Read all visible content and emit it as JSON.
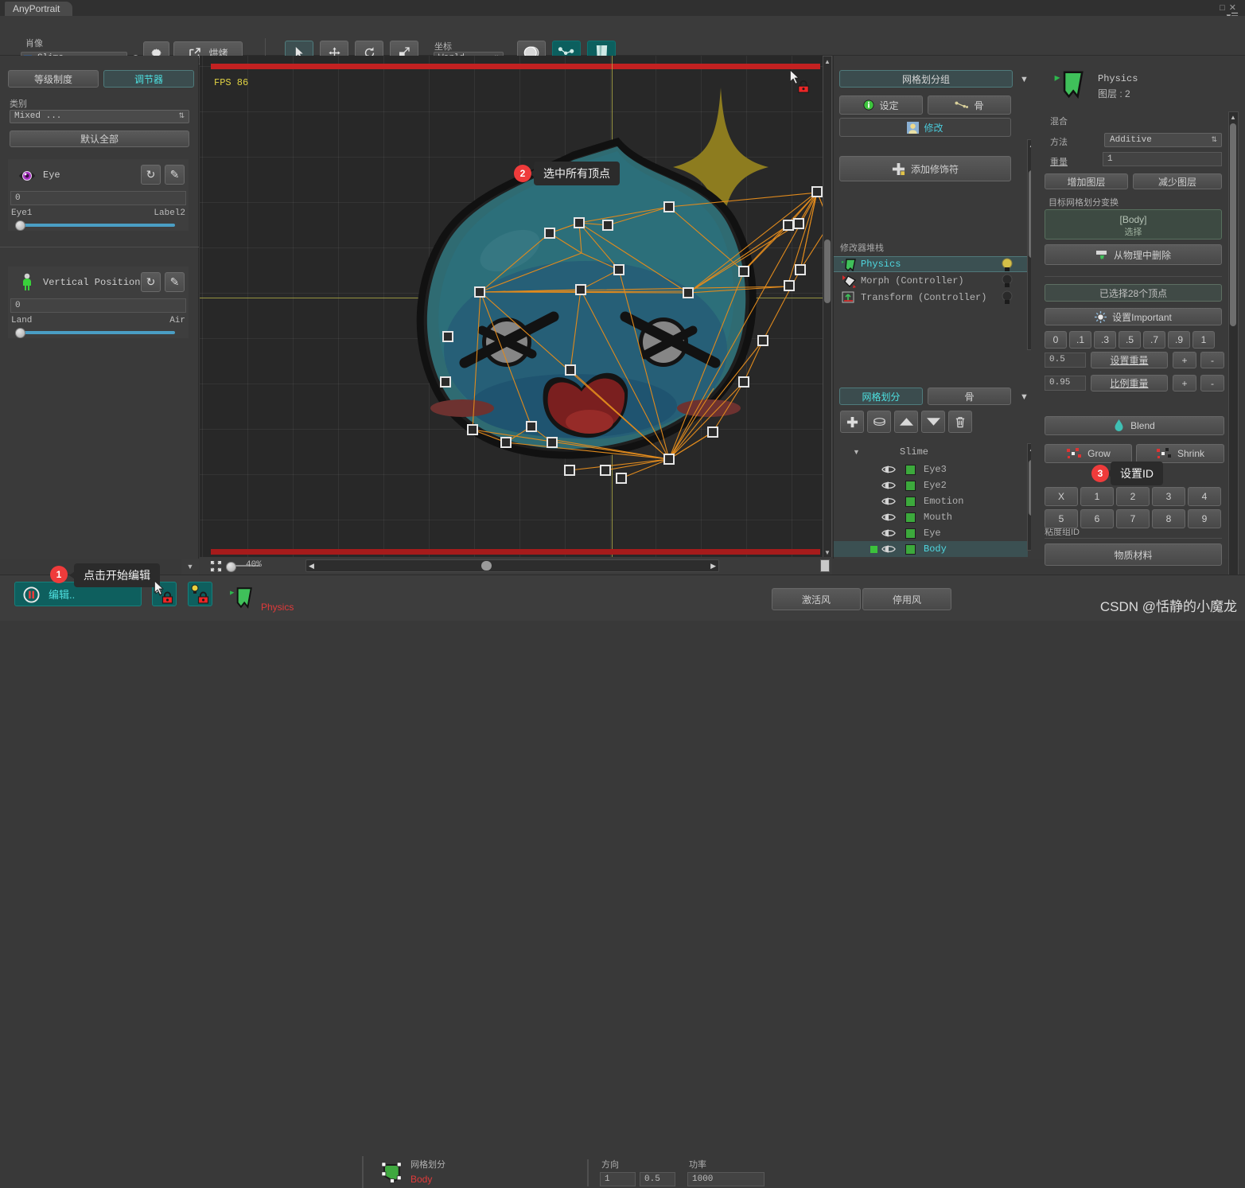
{
  "window": {
    "tab_title": "AnyPortrait",
    "maximize_icon": "maximize-icon",
    "close_icon": "close-icon",
    "menu_icon": "hamburger-menu-icon"
  },
  "toolbar": {
    "portrait_label": "肖像",
    "portrait_value": "Slime (apPortrait)",
    "gear_icon": "gear-icon",
    "bake_label": "烘烤",
    "bake_icon": "external-link-icon",
    "tools": [
      {
        "name": "select-tool",
        "icon": "cursor-arrow-icon",
        "active": true
      },
      {
        "name": "move-tool",
        "icon": "move-arrows-icon",
        "active": false
      },
      {
        "name": "rotate-tool",
        "icon": "rotate-icon",
        "active": false
      },
      {
        "name": "scale-tool",
        "icon": "scale-icon",
        "active": false
      }
    ],
    "coord_label": "坐标",
    "coord_value": "World",
    "right_tools": [
      {
        "name": "onion-skin-toggle",
        "icon": "onion-circle-icon",
        "active": false
      },
      {
        "name": "rigging-toggle",
        "icon": "bone-chain-icon",
        "active": true
      },
      {
        "name": "physics-toggle",
        "icon": "cloth-icon",
        "active": true
      }
    ]
  },
  "left_panel": {
    "tab_hierarchy": "等级制度",
    "tab_controller": "调节器",
    "category_label": "类别",
    "category_value": "Mixed ...",
    "default_all_button": "默认全部",
    "params": [
      {
        "name": "Eye",
        "icon": "eye-param-icon",
        "reset_icon": "reset-icon",
        "edit_icon": "pencil-icon",
        "value": "0",
        "min_label": "Eye1",
        "max_label": "Label2",
        "slider_pct": 0
      },
      {
        "name": "Vertical Position",
        "icon": "character-param-icon",
        "reset_icon": "reset-icon",
        "edit_icon": "pencil-icon",
        "value": "0",
        "min_label": "Land",
        "max_label": "Air",
        "slider_pct": 0
      }
    ]
  },
  "viewport": {
    "fps": "FPS 86",
    "zoom": "40%",
    "fit_icon": "fit-to-view-icon",
    "lock_icon": "lock-red-icon",
    "cursor_icon": "cursor-arrow-icon",
    "callout2_badge": "2",
    "callout2_text": "选中所有顶点"
  },
  "mid_panel": {
    "group_header": "网格划分组",
    "caret_icon": "chevron-down-icon",
    "btn_settings": "设定",
    "btn_settings_icon": "info-icon",
    "btn_bone": "骨",
    "btn_bone_icon": "bone-icon",
    "btn_modify": "修改",
    "btn_modify_icon": "portrait-icon",
    "add_modifier": "添加修饰符",
    "add_modifier_icon": "plus-icon",
    "stack_label": "修改器堆栈",
    "stack": [
      {
        "name": "Physics",
        "icon": "cloth-green-icon",
        "selected": true,
        "bulb": "on"
      },
      {
        "name": "Morph (Controller)",
        "icon": "morph-icon",
        "selected": false,
        "bulb": "off"
      },
      {
        "name": "Transform (Controller)",
        "icon": "transform-icon",
        "selected": false,
        "bulb": "off"
      }
    ],
    "tab_mesh": "网格划分",
    "tab_bone": "骨",
    "toolbar_icons": [
      "plus-icon",
      "duplicate-icon",
      "move-up-icon",
      "move-down-icon",
      "trash-icon"
    ],
    "tree_root": "Slime",
    "tree_root_caret": "triangle-down-icon",
    "tree_items": [
      {
        "name": "Eye3",
        "selected": false
      },
      {
        "name": "Eye2",
        "selected": false
      },
      {
        "name": "Emotion",
        "selected": false
      },
      {
        "name": "Mouth",
        "selected": false
      },
      {
        "name": "Eye",
        "selected": false
      },
      {
        "name": "Body",
        "selected": true
      }
    ]
  },
  "right_panel": {
    "title": "Physics",
    "subtitle": "图层 : 2",
    "icon": "cloth-green-icon",
    "blend_label": "混合",
    "method_label": "方法",
    "method_value": "Additive",
    "weight_label": "重量",
    "weight_value": "1",
    "btn_add_layer": "增加图层",
    "btn_sub_layer": "减少图层",
    "target_label": "目标网格划分变换",
    "target_value": "[Body]",
    "target_sub": "选择",
    "btn_remove_physics": "从物理中删除",
    "btn_remove_physics_icon": "remove-icon",
    "selected_info": "已选择28个顶点",
    "btn_important": "设置Important",
    "btn_important_icon": "important-icon",
    "weight_presets": [
      "0",
      ".1",
      ".3",
      ".5",
      ".7",
      ".9",
      "1"
    ],
    "weight_field_1": "0.5",
    "btn_set_weight": "设置重量",
    "weight_field_2": "0.95",
    "btn_ratio_weight": "比例重量",
    "plus_label": "+",
    "minus_label": "-",
    "btn_blend": "Blend",
    "btn_blend_icon": "drop-icon",
    "btn_grow": "Grow",
    "btn_grow_icon": "grow-icon",
    "btn_shrink": "Shrink",
    "btn_shrink_icon": "shrink-icon",
    "id_label": "粘度组ID",
    "callout3_badge": "3",
    "callout3_text": "设置ID",
    "id_buttons_row1": [
      "X",
      "1",
      "2",
      "3",
      "4"
    ],
    "id_buttons_row2": [
      "5",
      "6",
      "7",
      "8",
      "9"
    ],
    "btn_material": "物质材料"
  },
  "bottom_bar": {
    "edit_label": "编辑..",
    "edit_icon": "pause-icon",
    "callout1_badge": "1",
    "callout1_text": "点击开始编辑",
    "lock_cursor_icon": "cursor-lock-icon",
    "lock_bulb_icon": "bulb-lock-icon",
    "physics_icon": "cloth-green-icon",
    "physics_label": "Physics",
    "mesh_icon": "mesh-green-icon",
    "mesh_label": "网格划分",
    "mesh_value": "Body",
    "direction_label": "方向",
    "direction_x": "1",
    "direction_y": "0.5",
    "power_label": "功率",
    "power_value": "1000",
    "btn_activate_wind": "激活风",
    "btn_deactivate_wind": "停用风",
    "watermark": "CSDN @恬静的小魔龙"
  }
}
